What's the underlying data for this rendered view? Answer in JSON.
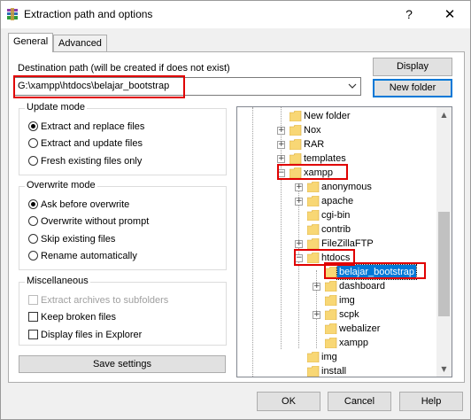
{
  "window": {
    "title": "Extraction path and options",
    "help_glyph": "?",
    "close_glyph": "✕",
    "icon": "winrar-archive-icon"
  },
  "tabs": [
    {
      "label": "General",
      "active": true
    },
    {
      "label": "Advanced",
      "active": false
    }
  ],
  "destination": {
    "label": "Destination path (will be created if does not exist)",
    "value": "G:\\xampp\\htdocs\\belajar_bootstrap",
    "display_button": "Display",
    "new_folder_button": "New folder"
  },
  "update_mode": {
    "title": "Update mode",
    "options": [
      {
        "label": "Extract and replace files",
        "selected": true
      },
      {
        "label": "Extract and update files",
        "selected": false
      },
      {
        "label": "Fresh existing files only",
        "selected": false
      }
    ]
  },
  "overwrite_mode": {
    "title": "Overwrite mode",
    "options": [
      {
        "label": "Ask before overwrite",
        "selected": true
      },
      {
        "label": "Overwrite without prompt",
        "selected": false
      },
      {
        "label": "Skip existing files",
        "selected": false
      },
      {
        "label": "Rename automatically",
        "selected": false
      }
    ]
  },
  "misc": {
    "title": "Miscellaneous",
    "options": [
      {
        "label": "Extract archives to subfolders",
        "checked": false,
        "disabled": true
      },
      {
        "label": "Keep broken files",
        "checked": false,
        "disabled": false
      },
      {
        "label": "Display files in Explorer",
        "checked": false,
        "disabled": false
      }
    ]
  },
  "save_settings": "Save settings",
  "tree": {
    "items": [
      {
        "label": "New folder"
      },
      {
        "label": "Nox"
      },
      {
        "label": "RAR"
      },
      {
        "label": "templates"
      },
      {
        "label": "xampp"
      },
      {
        "label": "anonymous"
      },
      {
        "label": "apache"
      },
      {
        "label": "cgi-bin"
      },
      {
        "label": "contrib"
      },
      {
        "label": "FileZillaFTP"
      },
      {
        "label": "htdocs"
      },
      {
        "label": "belajar_bootstrap"
      },
      {
        "label": "dashboard"
      },
      {
        "label": "img"
      },
      {
        "label": "scpk"
      },
      {
        "label": "webalizer"
      },
      {
        "label": "xampp"
      },
      {
        "label": "img"
      },
      {
        "label": "install"
      }
    ]
  },
  "buttons": {
    "ok": "OK",
    "cancel": "Cancel",
    "help": "Help"
  },
  "colors": {
    "highlight": "#0078d7",
    "annotation_red": "#e00000",
    "folder_yellow": "#f8d775"
  }
}
